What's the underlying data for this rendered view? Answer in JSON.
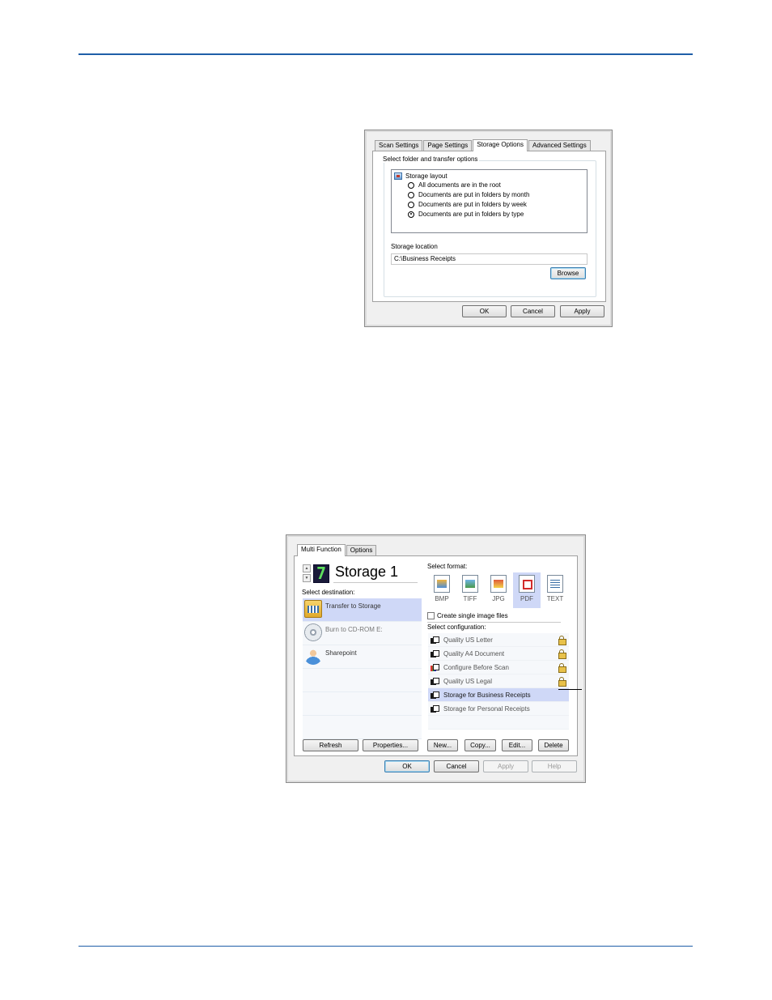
{
  "dialog1": {
    "tabs": [
      "Scan Settings",
      "Page Settings",
      "Storage Options",
      "Advanced Settings"
    ],
    "active_tab": "Storage Options",
    "group_title": "Select folder and transfer options",
    "tree_root": "Storage layout",
    "radios": [
      {
        "label": "All documents are in the root",
        "selected": false
      },
      {
        "label": "Documents are put in folders by month",
        "selected": false
      },
      {
        "label": "Documents are put in folders by week",
        "selected": false
      },
      {
        "label": "Documents are put in folders by type",
        "selected": true
      }
    ],
    "location_label": "Storage location",
    "location_value": "C:\\Business Receipts",
    "browse_label": "Browse",
    "ok_label": "OK",
    "cancel_label": "Cancel",
    "apply_label": "Apply"
  },
  "dialog2": {
    "tabs": [
      "Multi Function",
      "Options"
    ],
    "active_tab": "Multi Function",
    "destination_number": "7",
    "destination_title": "Storage 1",
    "select_destination_label": "Select destination:",
    "destinations": [
      {
        "label": "Transfer to Storage",
        "icon": "storage-icon",
        "selected": true
      },
      {
        "label": "Burn to CD-ROM  E:",
        "icon": "cd-icon",
        "selected": false
      },
      {
        "label": "Sharepoint",
        "icon": "sharepoint-icon",
        "selected": false
      }
    ],
    "select_format_label": "Select format:",
    "formats": [
      {
        "label": "BMP",
        "selected": false
      },
      {
        "label": "TIFF",
        "selected": false
      },
      {
        "label": "JPG",
        "selected": false
      },
      {
        "label": "PDF",
        "selected": true
      },
      {
        "label": "TEXT",
        "selected": false
      }
    ],
    "single_image_label": "Create single image files",
    "select_configuration_label": "Select configuration:",
    "configurations": [
      {
        "label": "Quality US Letter",
        "locked": true,
        "selected": false
      },
      {
        "label": "Quality A4 Document",
        "locked": true,
        "selected": false
      },
      {
        "label": "Configure Before Scan",
        "locked": true,
        "selected": false
      },
      {
        "label": "Quality US Legal",
        "locked": true,
        "selected": false
      },
      {
        "label": "Storage for Business Receipts",
        "locked": false,
        "selected": true
      },
      {
        "label": "Storage for Personal Receipts",
        "locked": false,
        "selected": false
      }
    ],
    "refresh_label": "Refresh",
    "properties_label": "Properties...",
    "new_label": "New...",
    "copy_label": "Copy...",
    "edit_label": "Edit...",
    "delete_label": "Delete",
    "ok_label": "OK",
    "cancel_label": "Cancel",
    "apply_label": "Apply",
    "help_label": "Help"
  },
  "colors": {
    "rule": "#1f5fa8",
    "selection": "#cfd8f7"
  }
}
